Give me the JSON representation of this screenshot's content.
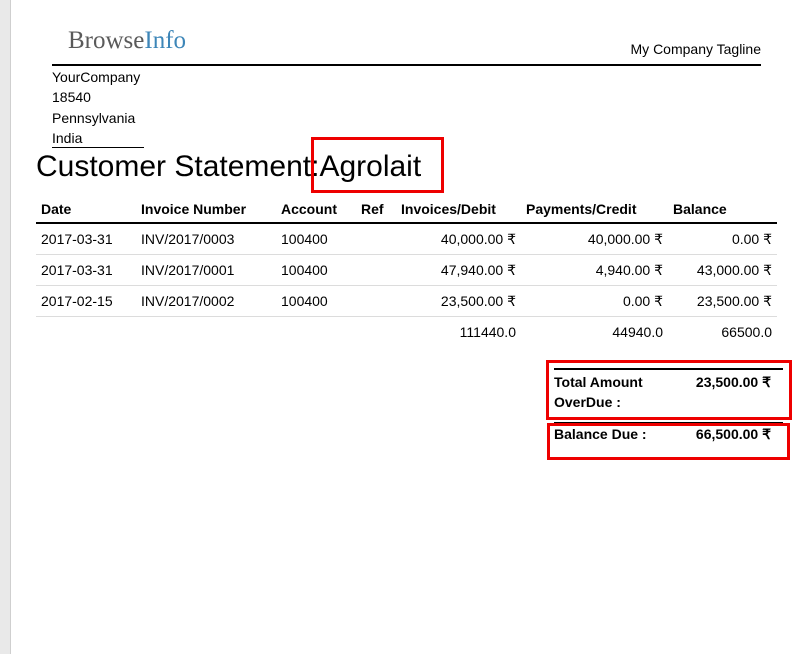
{
  "company": {
    "logo_part1": "Browse",
    "logo_part2": "Info",
    "tagline": "My Company Tagline",
    "address": [
      "YourCompany",
      "18540",
      "Pennsylvania",
      "India"
    ]
  },
  "statement": {
    "title_prefix": "Customer Statement:",
    "customer": "Agrolait"
  },
  "table": {
    "headers": [
      "Date",
      "Invoice Number",
      "Account",
      "Ref",
      "Invoices/Debit",
      "Payments/Credit",
      "Balance"
    ],
    "rows": [
      [
        "2017-03-31",
        "INV/2017/0003",
        "100400",
        "",
        "40,000.00 ₹",
        "40,000.00 ₹",
        "0.00 ₹"
      ],
      [
        "2017-03-31",
        "INV/2017/0001",
        "100400",
        "",
        "47,940.00 ₹",
        "4,940.00 ₹",
        "43,000.00 ₹"
      ],
      [
        "2017-02-15",
        "INV/2017/0002",
        "100400",
        "",
        "23,500.00 ₹",
        "0.00 ₹",
        "23,500.00 ₹"
      ]
    ],
    "totals": [
      "111440.0",
      "44940.0",
      "66500.0"
    ]
  },
  "summary": {
    "overdue_label_line1": "Total Amount",
    "overdue_label_line2": "OverDue :",
    "overdue_value": "23,500.00 ₹",
    "balance_label": "Balance Due :",
    "balance_value": "66,500.00 ₹"
  },
  "colors": {
    "highlight": "#ee0000",
    "logo_accent": "#3d86b8",
    "logo_gray": "#5a5a5a"
  }
}
